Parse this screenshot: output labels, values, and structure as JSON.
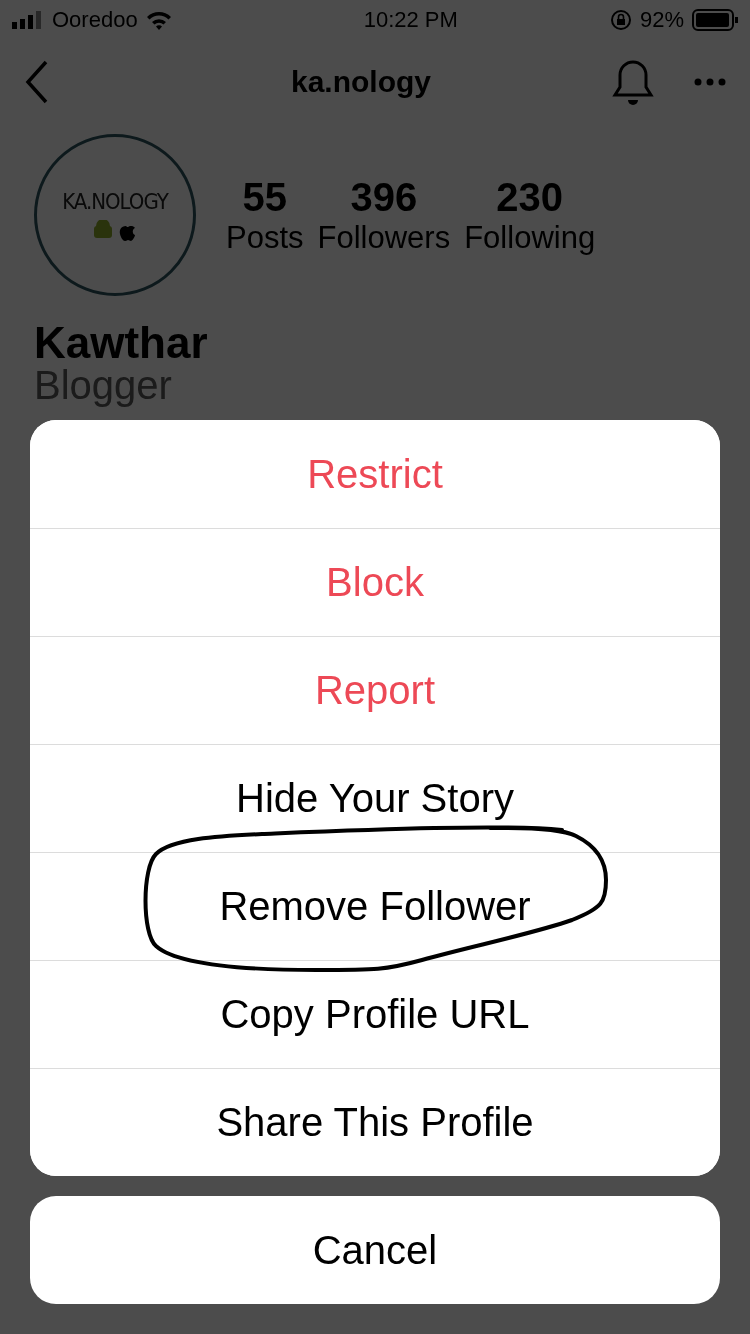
{
  "status_bar": {
    "carrier": "Ooredoo",
    "time": "10:22 PM",
    "battery": "92%"
  },
  "nav": {
    "title": "ka.nology"
  },
  "profile": {
    "avatar_text": "KA.NOLOGY",
    "name": "Kawthar",
    "bio": "Blogger",
    "stats": [
      {
        "value": "55",
        "label": "Posts"
      },
      {
        "value": "396",
        "label": "Followers"
      },
      {
        "value": "230",
        "label": "Following"
      }
    ]
  },
  "action_sheet": {
    "actions": [
      {
        "label": "Restrict",
        "kind": "destructive",
        "circled": false
      },
      {
        "label": "Block",
        "kind": "destructive",
        "circled": false
      },
      {
        "label": "Report",
        "kind": "destructive",
        "circled": false
      },
      {
        "label": "Hide Your Story",
        "kind": "default",
        "circled": false
      },
      {
        "label": "Remove Follower",
        "kind": "default",
        "circled": true
      },
      {
        "label": "Copy Profile URL",
        "kind": "default",
        "circled": false
      },
      {
        "label": "Share This Profile",
        "kind": "default",
        "circled": false
      }
    ],
    "cancel": "Cancel"
  }
}
